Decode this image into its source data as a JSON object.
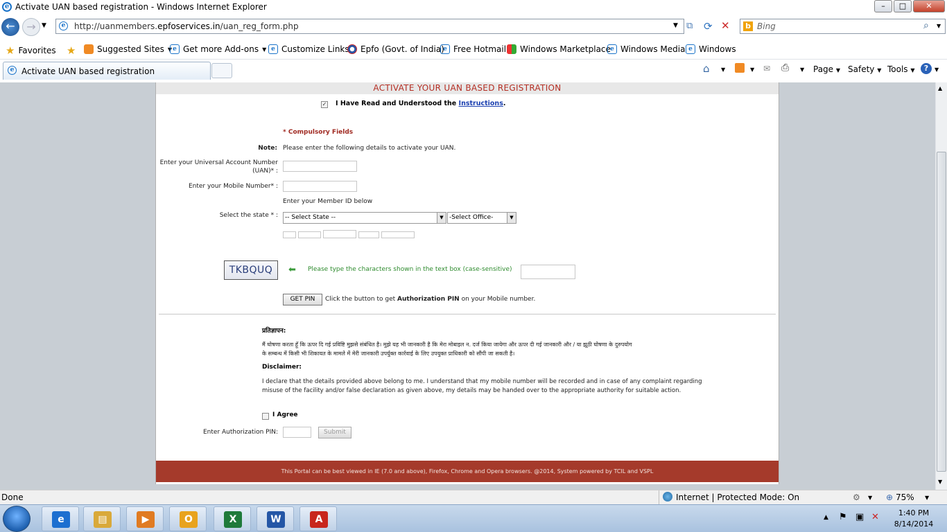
{
  "window": {
    "title": "Activate UAN based registration - Windows Internet Explorer",
    "min": "–",
    "max": "□",
    "close": "✕"
  },
  "nav": {
    "url_prefix": "http://uanmembers.",
    "url_domain": "epfoservices.in",
    "url_path": "/uan_reg_form.php",
    "search_placeholder": "Bing"
  },
  "favorites": {
    "label": "Favorites",
    "items": [
      {
        "label": "Suggested Sites",
        "dropdown": true
      },
      {
        "label": "Get more Add-ons",
        "dropdown": true
      },
      {
        "label": "Customize Links"
      },
      {
        "label": "Epfo (Govt. of India)"
      },
      {
        "label": "Free Hotmail"
      },
      {
        "label": "Windows Marketplace"
      },
      {
        "label": "Windows Media"
      },
      {
        "label": "Windows"
      }
    ]
  },
  "tabs": [
    {
      "label": "Activate UAN based registration"
    }
  ],
  "commands": {
    "page": "Page",
    "safety": "Safety",
    "tools": "Tools"
  },
  "page": {
    "heading": "ACTIVATE YOUR UAN BASED REGISTRATION",
    "read_label": "I Have Read and Understood the ",
    "instructions_link": "Instructions",
    "period": ".",
    "compulsory": "* Compulsory Fields",
    "note_label": "Note:",
    "note_text": "Please enter the following details to activate your UAN.",
    "uan_label_1": "Enter your Universal Account Number",
    "uan_label_2": "(UAN)* :",
    "mobile_label": "Enter your Mobile Number* :",
    "member_id_hint": "Enter your Member ID below",
    "state_label": "Select the state * :",
    "state_selected": "-- Select State --",
    "office_selected": "-Select Office-",
    "captcha": "TKBQUQ",
    "captcha_hint": "Please type the characters shown in the text box (case-sensitive)",
    "get_pin_button": "GET PIN",
    "get_pin_text_1": "Click the button to get ",
    "get_pin_text_bold": "Authorization PIN",
    "get_pin_text_2": " on your Mobile number.",
    "hindi_heading": "प्रतिज्ञापन:",
    "hindi_text_1": "मैं घोषणा करता हूँ कि ऊपर दि गई प्रविष्टि मुझसे संबंधित है। मुझे यह भी जानकारी है कि मेरा मोबाइल न. दर्ज किया जायेगा और ऊपर दी गई जानकारी और / या झूठी घोषणा के दुरुपयोग",
    "hindi_text_2": "के सम्बन्ध में किसी भी शिकायत के मामले में मेरी जानकारी उपर्युक्त कार्रवाई के लिए उपयुक्त प्राधिकारी को सौंपी जा सकती है।",
    "disclaimer_heading": "Disclaimer:",
    "disclaimer_1": "I declare that the details provided above belong to me. I understand that my mobile number will be recorded and in case of any complaint regarding",
    "disclaimer_2": "misuse of the facility and/or false declaration as given above, my details may be handed over to the appropriate authority for suitable action.",
    "agree_label": "I Agree",
    "auth_pin_label": "Enter Authorization PIN:",
    "submit_button": "Submit",
    "footer": "This Portal can be best viewed in IE (7.0 and above), Firefox, Chrome and Opera browsers.       @2014, System powered by TCIL and VSPL"
  },
  "status": {
    "left": "Done",
    "zone": "Internet | Protected Mode: On",
    "zoom": "75%"
  },
  "taskbar": {
    "time": "1:40 PM",
    "date": "8/14/2014",
    "apps": [
      {
        "icon": "internet-explorer-icon",
        "glyph": "e",
        "color": "#1d6fd0"
      },
      {
        "icon": "file-explorer-icon",
        "glyph": "▤",
        "color": "#d9a93a"
      },
      {
        "icon": "media-player-icon",
        "glyph": "▶",
        "color": "#e07b22"
      },
      {
        "icon": "outlook-icon",
        "glyph": "O",
        "color": "#e8a31d"
      },
      {
        "icon": "excel-icon",
        "glyph": "X",
        "color": "#1f7a3a"
      },
      {
        "icon": "word-icon",
        "glyph": "W",
        "color": "#2456a6"
      },
      {
        "icon": "acrobat-icon",
        "glyph": "A",
        "color": "#c8261d"
      }
    ]
  }
}
